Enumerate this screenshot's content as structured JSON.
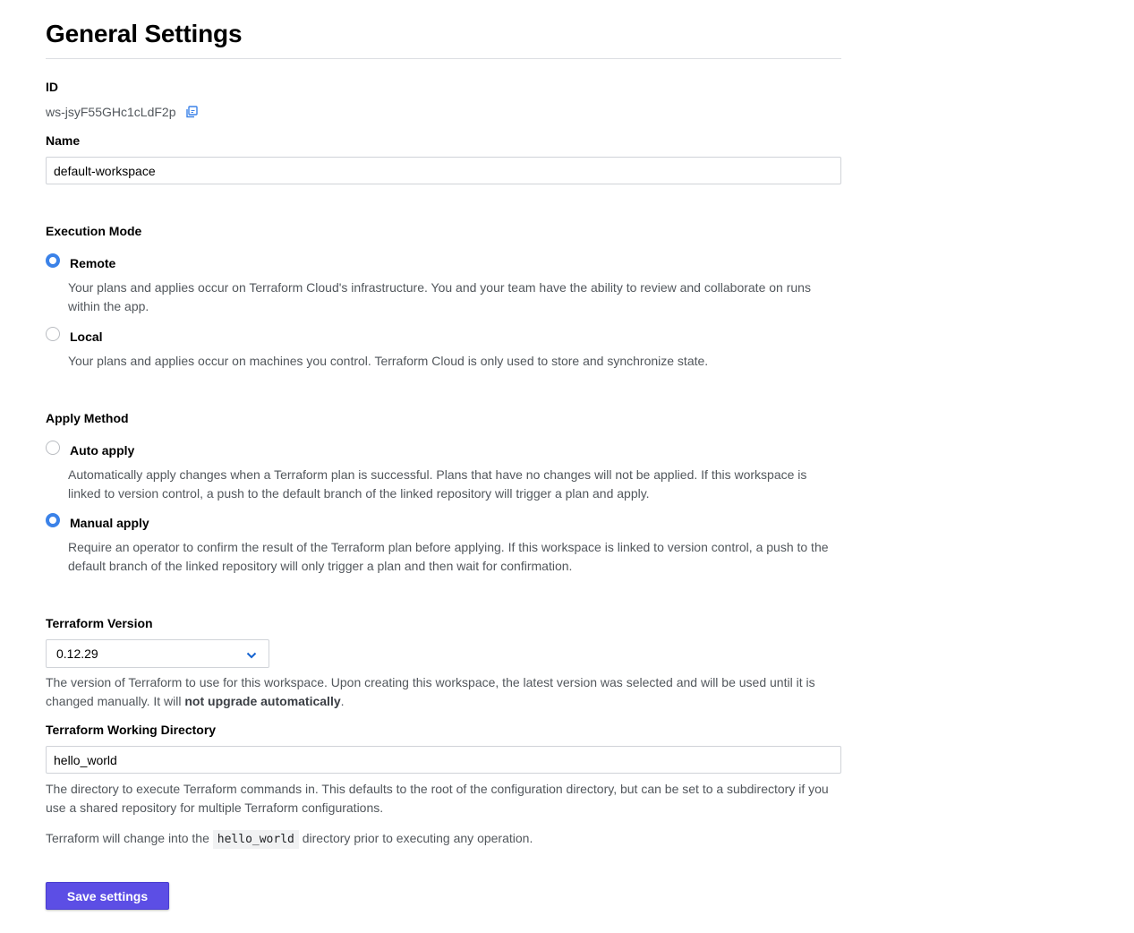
{
  "page": {
    "title": "General Settings"
  },
  "id_section": {
    "label": "ID",
    "value": "ws-jsyF55GHc1cLdF2p",
    "copy_icon": "copy-icon"
  },
  "name_section": {
    "label": "Name",
    "value": "default-workspace"
  },
  "execution_mode": {
    "label": "Execution Mode",
    "options": [
      {
        "label": "Remote",
        "description": "Your plans and applies occur on Terraform Cloud's infrastructure. You and your team have the ability to review and collaborate on runs within the app.",
        "selected": true
      },
      {
        "label": "Local",
        "description": "Your plans and applies occur on machines you control. Terraform Cloud is only used to store and synchronize state.",
        "selected": false
      }
    ]
  },
  "apply_method": {
    "label": "Apply Method",
    "options": [
      {
        "label": "Auto apply",
        "description": "Automatically apply changes when a Terraform plan is successful. Plans that have no changes will not be applied. If this workspace is linked to version control, a push to the default branch of the linked repository will trigger a plan and apply.",
        "selected": false
      },
      {
        "label": "Manual apply",
        "description": "Require an operator to confirm the result of the Terraform plan before applying. If this workspace is linked to version control, a push to the default branch of the linked repository will only trigger a plan and then wait for confirmation.",
        "selected": true
      }
    ]
  },
  "terraform_version": {
    "label": "Terraform Version",
    "selected": "0.12.29",
    "help_prefix": "The version of Terraform to use for this workspace. Upon creating this workspace, the latest version was selected and will be used until it is changed manually. It will ",
    "help_bold": "not upgrade automatically",
    "help_suffix": "."
  },
  "working_directory": {
    "label": "Terraform Working Directory",
    "value": "hello_world",
    "help": "The directory to execute Terraform commands in. This defaults to the root of the configuration directory, but can be set to a subdirectory if you use a shared repository for multiple Terraform configurations.",
    "note_prefix": "Terraform will change into the ",
    "note_code": "hello_world",
    "note_suffix": " directory prior to executing any operation."
  },
  "actions": {
    "save_label": "Save settings"
  },
  "colors": {
    "accent": "#3b82e8",
    "button": "#5c4ee5",
    "text_muted": "#52575c"
  }
}
